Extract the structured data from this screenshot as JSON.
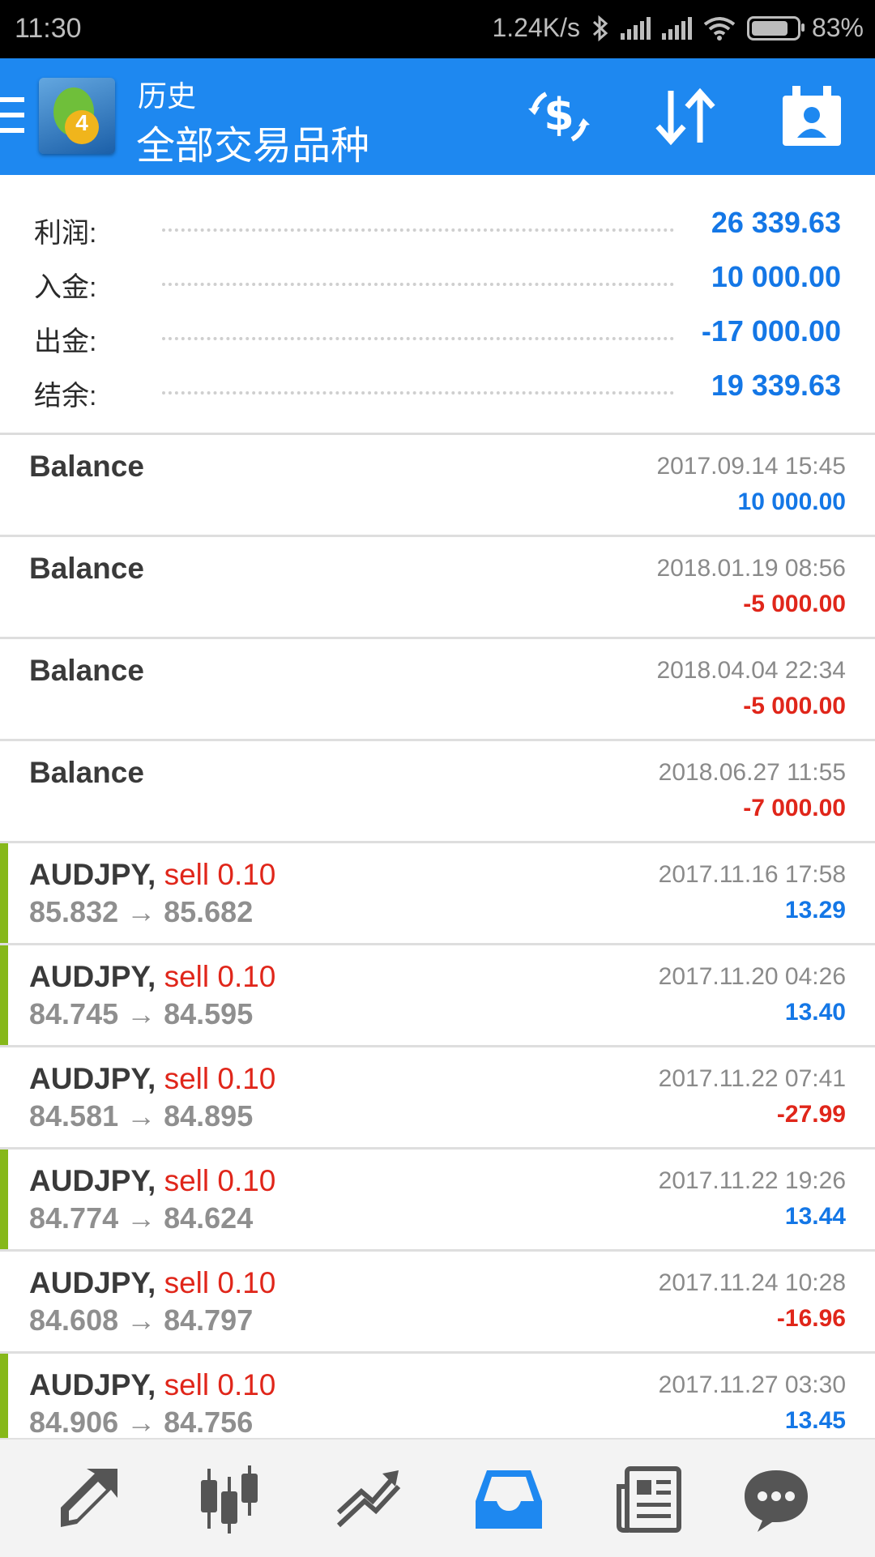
{
  "status_bar": {
    "time": "11:30",
    "network_speed": "1.24K/s",
    "battery": "83%",
    "icons": [
      "bluetooth-icon",
      "signal-icon",
      "signal-icon",
      "wifi-icon",
      "battery-icon"
    ]
  },
  "app_bar": {
    "subtitle": "历史",
    "title": "全部交易品种",
    "actions": [
      "currency-filter-icon",
      "sort-icon",
      "calendar-period-icon"
    ],
    "color": "#1e88f0"
  },
  "summary": [
    {
      "label": "利润:",
      "value": "26 339.63"
    },
    {
      "label": "入金:",
      "value": "10 000.00"
    },
    {
      "label": "出金:",
      "value": "-17 000.00"
    },
    {
      "label": "结余:",
      "value": "19 339.63"
    }
  ],
  "history": [
    {
      "name": "Balance",
      "time": "2017.09.14 15:45",
      "amount": "10 000.00",
      "positive": true
    },
    {
      "name": "Balance",
      "time": "2018.01.19 08:56",
      "amount": "-5 000.00",
      "positive": false
    },
    {
      "name": "Balance",
      "time": "2018.04.04 22:34",
      "amount": "-5 000.00",
      "positive": false
    },
    {
      "name": "Balance",
      "time": "2018.06.27 11:55",
      "amount": "-7 000.00",
      "positive": false
    },
    {
      "name": "AUDJPY,",
      "op": "sell 0.10",
      "prices": "85.832 → 85.682",
      "time": "2017.11.16 17:58",
      "amount": "13.29",
      "positive": true
    },
    {
      "name": "AUDJPY,",
      "op": "sell 0.10",
      "prices": "84.745 → 84.595",
      "time": "2017.11.20 04:26",
      "amount": "13.40",
      "positive": true
    },
    {
      "name": "AUDJPY,",
      "op": "sell 0.10",
      "prices": "84.581 → 84.895",
      "time": "2017.11.22 07:41",
      "amount": "-27.99",
      "positive": false
    },
    {
      "name": "AUDJPY,",
      "op": "sell 0.10",
      "prices": "84.774 → 84.624",
      "time": "2017.11.22 19:26",
      "amount": "13.44",
      "positive": true
    },
    {
      "name": "AUDJPY,",
      "op": "sell 0.10",
      "prices": "84.608 → 84.797",
      "time": "2017.11.24 10:28",
      "amount": "-16.96",
      "positive": false
    },
    {
      "name": "AUDJPY,",
      "op": "sell 0.10",
      "prices": "84.906 → 84.756",
      "time": "2017.11.27 03:30",
      "amount": "13.45",
      "positive": true
    }
  ],
  "bottom_nav": [
    {
      "icon": "quotes-icon",
      "active": false
    },
    {
      "icon": "chart-icon",
      "active": false
    },
    {
      "icon": "trade-icon",
      "active": false
    },
    {
      "icon": "history-icon",
      "active": true
    },
    {
      "icon": "news-icon",
      "active": false
    },
    {
      "icon": "chat-icon",
      "active": false
    }
  ],
  "colors": {
    "positive": "#1477e6",
    "negative": "#e0261a",
    "profit_bar": "#86b81a",
    "nav_active": "#1e88f0",
    "nav_inactive": "#555555"
  }
}
